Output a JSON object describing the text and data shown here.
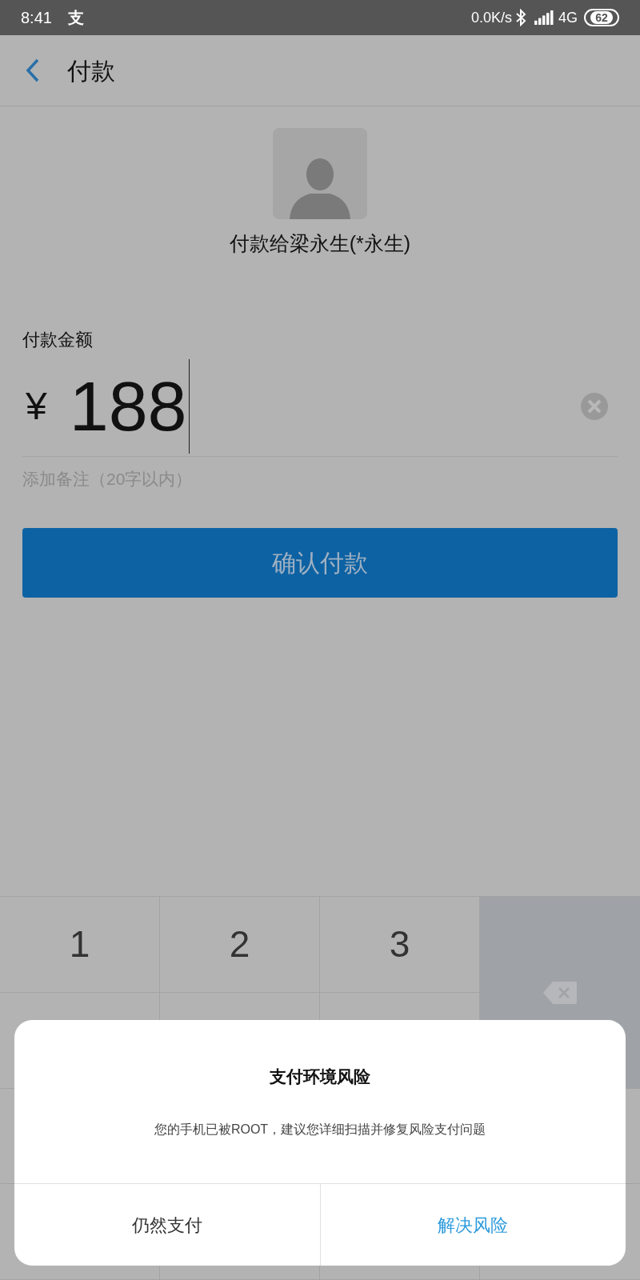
{
  "status_bar": {
    "time": "8:41",
    "app_glyph": "支",
    "net_speed": "0.0K/s",
    "network": "4G",
    "battery": "62"
  },
  "header": {
    "title": "付款"
  },
  "payee": {
    "name": "付款给梁永生(*永生)"
  },
  "amount": {
    "label": "付款金额",
    "currency": "¥",
    "value": "188"
  },
  "note": {
    "placeholder": "添加备注（20字以内）"
  },
  "confirm_button": {
    "label": "确认付款"
  },
  "keypad": {
    "keys": [
      "1",
      "2",
      "3"
    ]
  },
  "dialog": {
    "title": "支付环境风险",
    "message": "您的手机已被ROOT，建议您详细扫描并修复风险支付问题",
    "buttons": [
      {
        "label": "仍然支付",
        "kind": "secondary"
      },
      {
        "label": "解决风险",
        "kind": "primary"
      }
    ]
  }
}
